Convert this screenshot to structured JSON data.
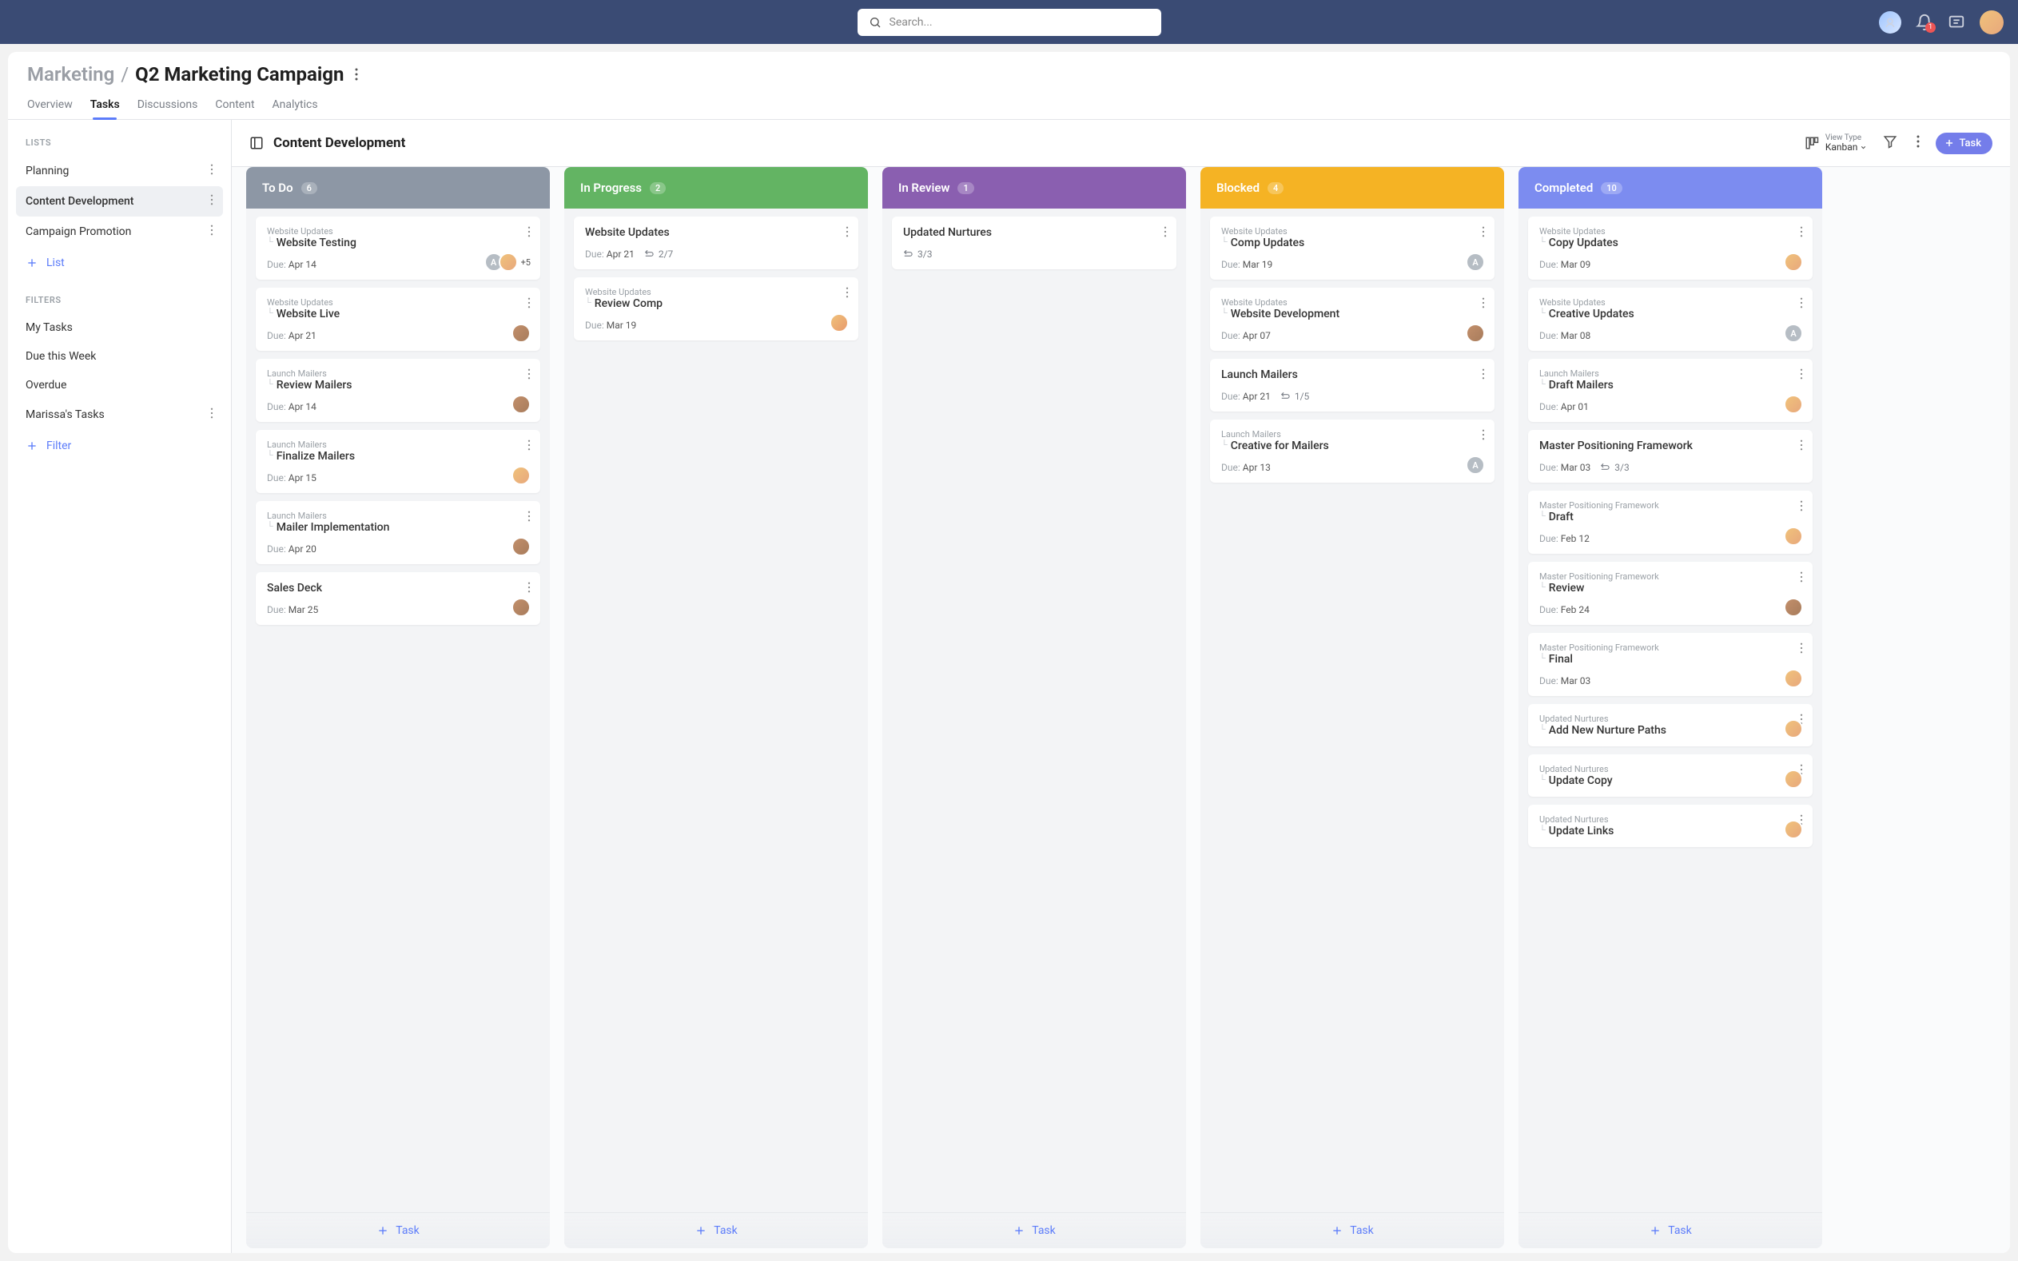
{
  "search": {
    "placeholder": "Search..."
  },
  "notifications": {
    "count": "1"
  },
  "breadcrumb": {
    "parent": "Marketing",
    "title": "Q2 Marketing Campaign"
  },
  "tabs": [
    {
      "label": "Overview"
    },
    {
      "label": "Tasks",
      "active": true
    },
    {
      "label": "Discussions"
    },
    {
      "label": "Content"
    },
    {
      "label": "Analytics"
    }
  ],
  "sidebar": {
    "section_lists": "LISTS",
    "section_filters": "FILTERS",
    "lists": [
      {
        "label": "Planning",
        "menu": true
      },
      {
        "label": "Content Development",
        "active": true,
        "menu": true
      },
      {
        "label": "Campaign Promotion",
        "menu": true
      }
    ],
    "add_list_label": "List",
    "filters": [
      {
        "label": "My Tasks"
      },
      {
        "label": "Due this Week"
      },
      {
        "label": "Overdue"
      },
      {
        "label": "Marissa's Tasks",
        "menu": true
      }
    ],
    "add_filter_label": "Filter"
  },
  "board": {
    "title": "Content Development",
    "view_type_label": "View Type",
    "view_type_value": "Kanban",
    "new_task_label": "Task",
    "add_task_label": "Task",
    "due_label": "Due:"
  },
  "columns": [
    {
      "name": "To Do",
      "count": "6",
      "color": "#8d97a5",
      "cards": [
        {
          "parent": "Website Updates",
          "title": "Website Testing",
          "due": "Apr 14",
          "avatars": [
            "A",
            "av-1"
          ],
          "more": "+5"
        },
        {
          "parent": "Website Updates",
          "title": "Website Live",
          "due": "Apr 21",
          "avatars": [
            "av-3"
          ]
        },
        {
          "parent": "Launch Mailers",
          "title": "Review Mailers",
          "due": "Apr 14",
          "avatars": [
            "av-3"
          ]
        },
        {
          "parent": "Launch Mailers",
          "title": "Finalize Mailers",
          "due": "Apr 15",
          "avatars": [
            "av-1"
          ]
        },
        {
          "parent": "Launch Mailers",
          "title": "Mailer Implementation",
          "due": "Apr 20",
          "avatars": [
            "av-3"
          ]
        },
        {
          "title": "Sales Deck",
          "due": "Mar 25",
          "avatars": [
            "av-3"
          ]
        }
      ]
    },
    {
      "name": "In Progress",
      "count": "2",
      "color": "#63b463",
      "cards": [
        {
          "title": "Website Updates",
          "due": "Apr 21",
          "subtasks": "2/7"
        },
        {
          "parent": "Website Updates",
          "title": "Review Comp",
          "due": "Mar 19",
          "avatars": [
            "av-2"
          ]
        }
      ]
    },
    {
      "name": "In Review",
      "count": "1",
      "color": "#8a5fb0",
      "cards": [
        {
          "title": "Updated Nurtures",
          "subtasks": "3/3"
        }
      ]
    },
    {
      "name": "Blocked",
      "count": "4",
      "color": "#f5b324",
      "cards": [
        {
          "parent": "Website Updates",
          "title": "Comp Updates",
          "due": "Mar 19",
          "avatars": [
            "A"
          ]
        },
        {
          "parent": "Website Updates",
          "title": "Website Development",
          "due": "Apr 07",
          "avatars": [
            "av-3"
          ]
        },
        {
          "title": "Launch Mailers",
          "due": "Apr 21",
          "subtasks": "1/5"
        },
        {
          "parent": "Launch Mailers",
          "title": "Creative for Mailers",
          "due": "Apr 13",
          "avatars": [
            "A"
          ]
        }
      ]
    },
    {
      "name": "Completed",
      "count": "10",
      "color": "#7c8cf0",
      "cards": [
        {
          "parent": "Website Updates",
          "title": "Copy Updates",
          "due": "Mar 09",
          "avatars": [
            "av-1"
          ]
        },
        {
          "parent": "Website Updates",
          "title": "Creative Updates",
          "due": "Mar 08",
          "avatars": [
            "A"
          ]
        },
        {
          "parent": "Launch Mailers",
          "title": "Draft Mailers",
          "due": "Apr 01",
          "avatars": [
            "av-1"
          ]
        },
        {
          "title": "Master Positioning Framework",
          "due": "Mar 03",
          "subtasks": "3/3"
        },
        {
          "parent": "Master Positioning Framework",
          "title": "Draft",
          "due": "Feb 12",
          "avatars": [
            "av-1"
          ]
        },
        {
          "parent": "Master Positioning Framework",
          "title": "Review",
          "due": "Feb 24",
          "avatars": [
            "av-3"
          ]
        },
        {
          "parent": "Master Positioning Framework",
          "title": "Final",
          "due": "Mar 03",
          "avatars": [
            "av-1"
          ]
        },
        {
          "parent": "Updated Nurtures",
          "title": "Add New Nurture Paths",
          "avatars": [
            "av-1"
          ]
        },
        {
          "parent": "Updated Nurtures",
          "title": "Update Copy",
          "avatars": [
            "av-1"
          ]
        },
        {
          "parent": "Updated Nurtures",
          "title": "Update Links",
          "avatars": [
            "av-1"
          ]
        }
      ]
    }
  ]
}
